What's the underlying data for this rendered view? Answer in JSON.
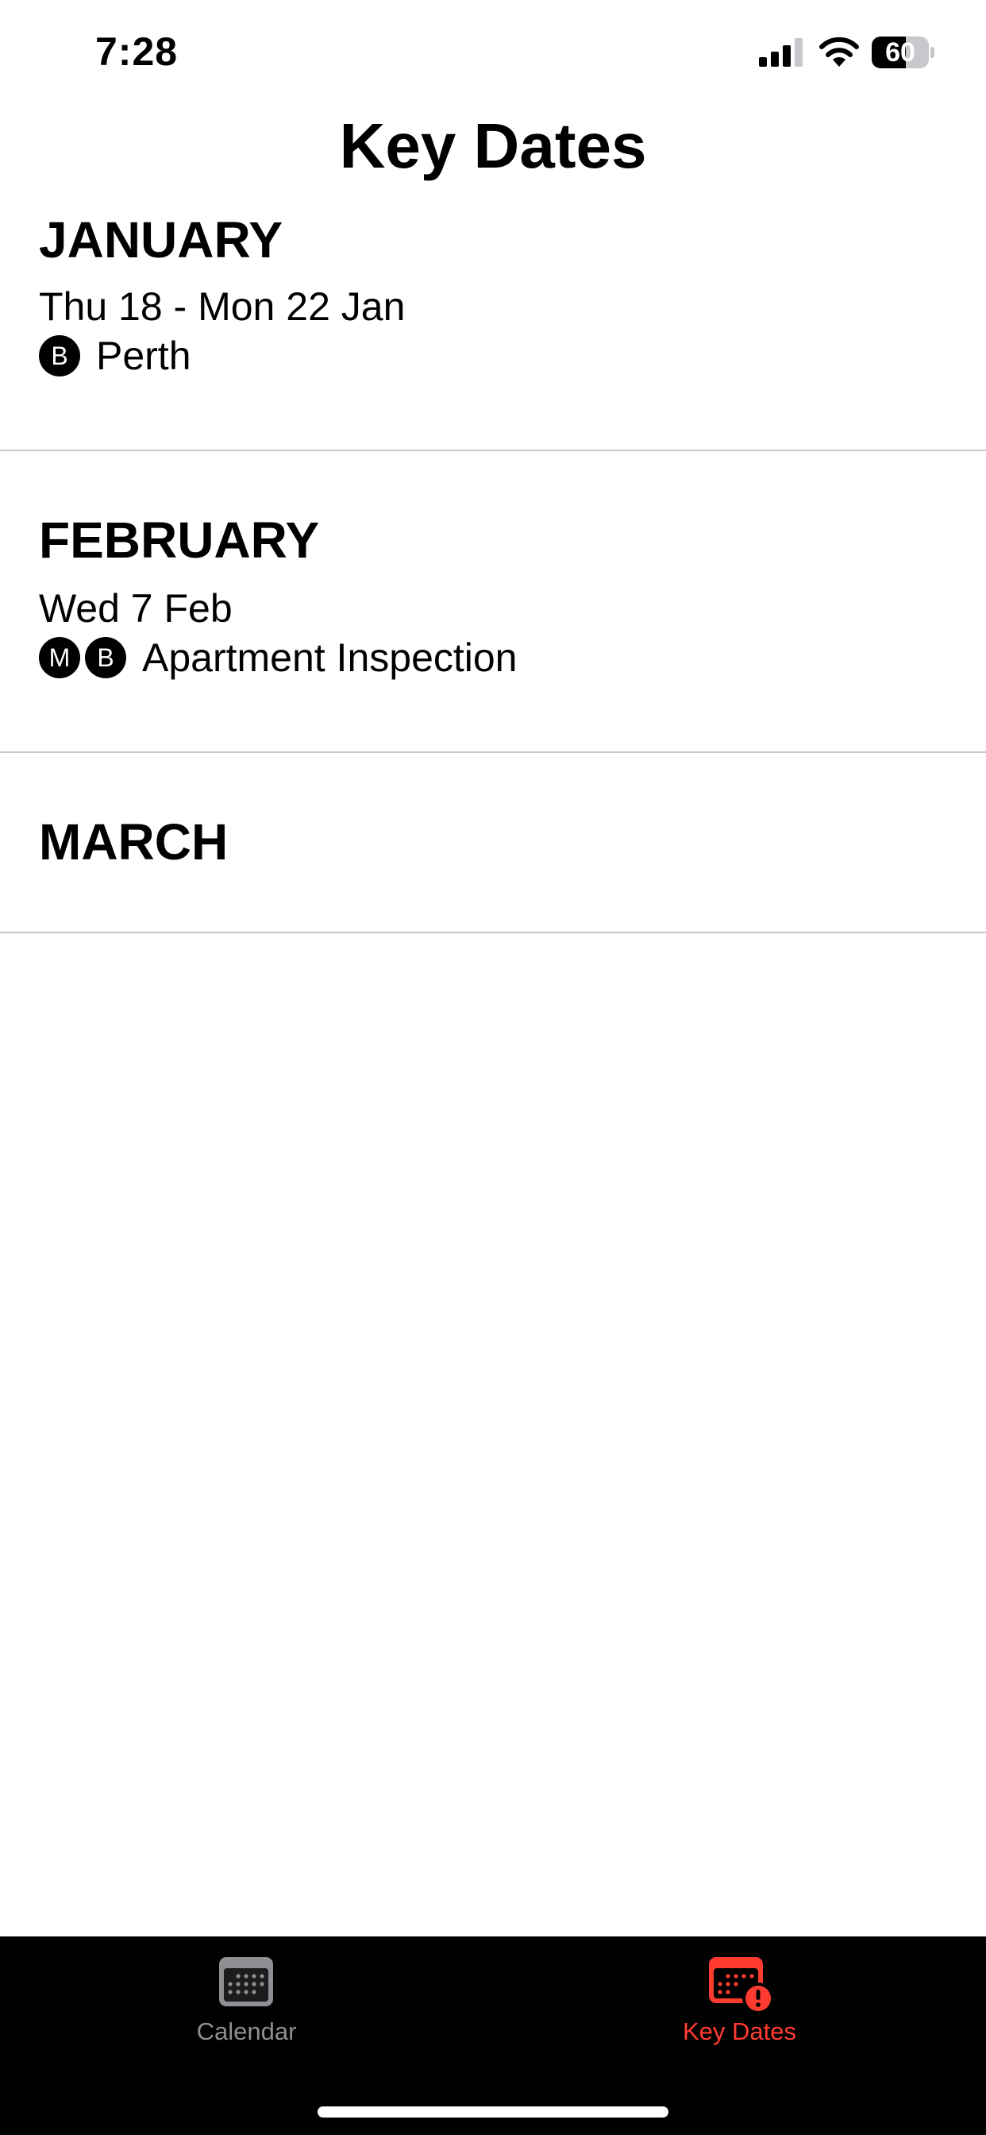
{
  "status_bar": {
    "time": "7:28",
    "battery": "60",
    "battery_level": 0.6
  },
  "title": "Key Dates",
  "sections": [
    {
      "month": "JANUARY",
      "events": [
        {
          "date": "Thu 18 - Mon 22 Jan",
          "people": [
            "B"
          ],
          "title": "Perth"
        }
      ]
    },
    {
      "month": "FEBRUARY",
      "events": [
        {
          "date": "Wed 7 Feb",
          "people": [
            "M",
            "B"
          ],
          "title": "Apartment Inspection"
        }
      ]
    },
    {
      "month": "MARCH",
      "events": []
    }
  ],
  "tab_bar": {
    "items": [
      {
        "label": "Calendar",
        "icon": "calendar-icon",
        "active": false
      },
      {
        "label": "Key Dates",
        "icon": "calendar-alert-icon",
        "active": true
      }
    ],
    "colors": {
      "active": "#ff3b30",
      "inactive": "#8e8e93",
      "background": "#000000"
    }
  }
}
